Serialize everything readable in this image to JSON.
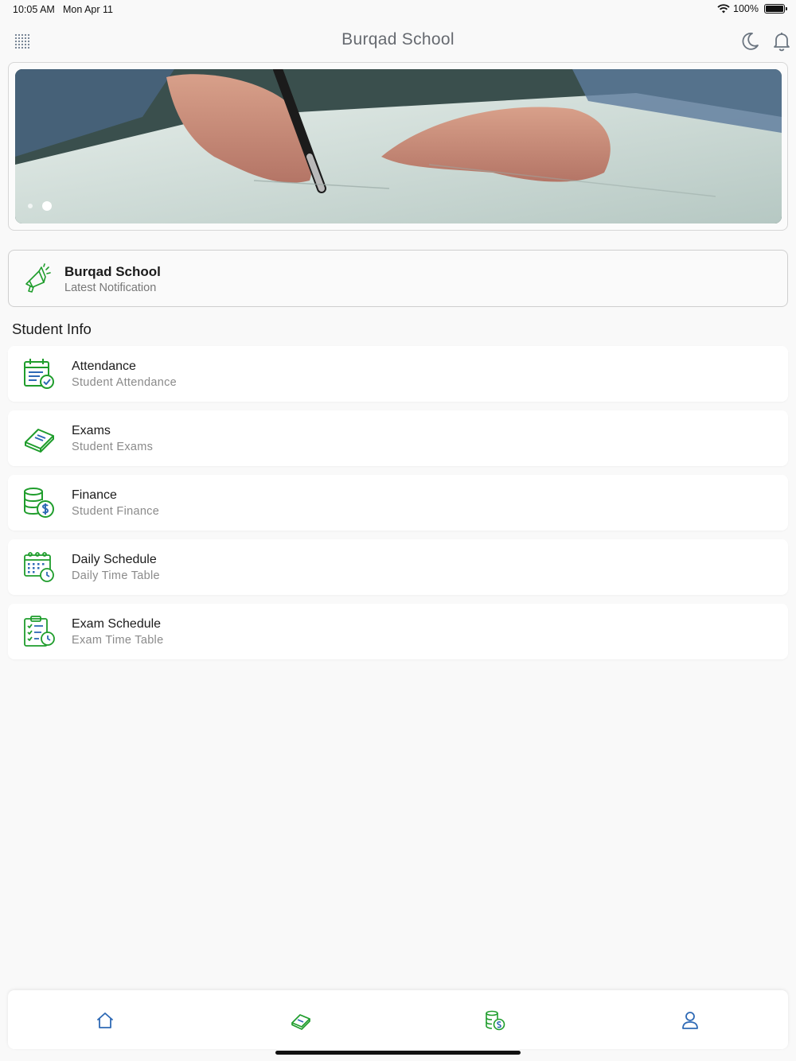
{
  "status_bar": {
    "time": "10:05 AM",
    "date": "Mon Apr 11",
    "battery": "100%"
  },
  "header": {
    "title": "Burqad School",
    "icons": [
      "menu-grid-icon",
      "moon-icon",
      "bell-icon"
    ]
  },
  "banner": {
    "icon": "writing-hand-photo",
    "slides": 2,
    "active_slide": 2
  },
  "notification": {
    "title": "Burqad School",
    "subtitle": "Latest Notification",
    "icon": "megaphone-icon"
  },
  "section": {
    "title": "Student Info"
  },
  "items": [
    {
      "label": "Attendance",
      "sub": "Student Attendance",
      "icon": "attendance-icon"
    },
    {
      "label": "Exams",
      "sub": "Student Exams",
      "icon": "exam-book-icon"
    },
    {
      "label": "Finance",
      "sub": "Student Finance",
      "icon": "finance-coins-icon"
    },
    {
      "label": "Daily Schedule",
      "sub": "Daily Time Table",
      "icon": "calendar-clock-icon"
    },
    {
      "label": "Exam Schedule",
      "sub": "Exam Time Table",
      "icon": "checklist-clock-icon"
    }
  ],
  "tab_bar": {
    "tabs": [
      "home-icon",
      "exam-book-icon",
      "finance-coins-icon",
      "profile-icon"
    ]
  },
  "colors": {
    "accent_green": "#1f9d2c",
    "accent_blue": "#2f6ab5",
    "text_gray": "#666a70"
  }
}
